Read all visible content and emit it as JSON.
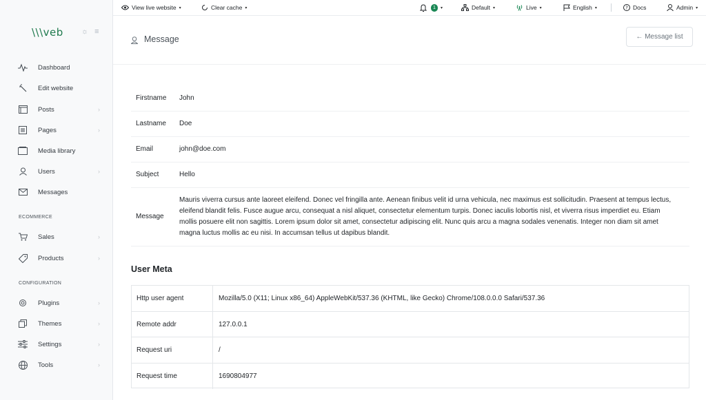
{
  "sidebar": {
    "logo": "\\\\\\veb",
    "logo_tools": "☼ ≡",
    "items": [
      {
        "label": "Dashboard",
        "icon": "pulse-icon"
      },
      {
        "label": "Edit website",
        "icon": "wand-icon"
      },
      {
        "label": "Posts",
        "icon": "posts-icon",
        "chevron": true
      },
      {
        "label": "Pages",
        "icon": "pages-icon",
        "chevron": true
      },
      {
        "label": "Media library",
        "icon": "media-icon"
      },
      {
        "label": "Users",
        "icon": "user-icon",
        "chevron": true
      },
      {
        "label": "Messages",
        "icon": "envelope-icon"
      }
    ],
    "section_ecommerce": "ECOMMERCE",
    "ecommerce_items": [
      {
        "label": "Sales",
        "icon": "cart-icon",
        "chevron": true
      },
      {
        "label": "Products",
        "icon": "tag-icon",
        "chevron": true
      }
    ],
    "section_configuration": "CONFIGURATION",
    "config_items": [
      {
        "label": "Plugins",
        "icon": "plugin-icon",
        "chevron": true
      },
      {
        "label": "Themes",
        "icon": "themes-icon",
        "chevron": true
      },
      {
        "label": "Settings",
        "icon": "sliders-icon",
        "chevron": true
      },
      {
        "label": "Tools",
        "icon": "globe-icon",
        "chevron": true
      }
    ],
    "chevron": "›"
  },
  "topbar": {
    "view_live": "View live website",
    "clear_cache": "Clear cache",
    "notifications_count": "1",
    "default": "Default",
    "live": "Live",
    "language": "English",
    "docs": "Docs",
    "admin": "Admin",
    "caret": "▾"
  },
  "header": {
    "title": "Message",
    "back_button": "← Message list"
  },
  "message": {
    "rows": [
      {
        "key": "Firstname",
        "value": "John"
      },
      {
        "key": "Lastname",
        "value": "Doe"
      },
      {
        "key": "Email",
        "value": "john@doe.com"
      },
      {
        "key": "Subject",
        "value": "Hello"
      },
      {
        "key": "Message",
        "value": "Mauris viverra cursus ante laoreet eleifend. Donec vel fringilla ante. Aenean finibus velit id urna vehicula, nec maximus est sollicitudin. Praesent at tempus lectus, eleifend blandit felis. Fusce augue arcu, consequat a nisl aliquet, consectetur elementum turpis. Donec iaculis lobortis nisl, et viverra risus imperdiet eu. Etiam mollis posuere elit non sagittis. Lorem ipsum dolor sit amet, consectetur adipiscing elit. Nunc quis arcu a magna sodales venenatis. Integer non diam sit amet magna luctus mollis ac eu nisi. In accumsan tellus ut dapibus blandit."
      }
    ]
  },
  "user_meta": {
    "title": "User Meta",
    "rows": [
      {
        "key": "Http user agent",
        "value": "Mozilla/5.0 (X11; Linux x86_64) AppleWebKit/537.36 (KHTML, like Gecko) Chrome/108.0.0.0 Safari/537.36"
      },
      {
        "key": "Remote addr",
        "value": "127.0.0.1"
      },
      {
        "key": "Request uri",
        "value": "/"
      },
      {
        "key": "Request time",
        "value": "1690804977"
      }
    ]
  },
  "colors": {
    "accent": "#198754",
    "logo": "#1f7a4d",
    "sidebar_bg": "#f8f9fa"
  }
}
